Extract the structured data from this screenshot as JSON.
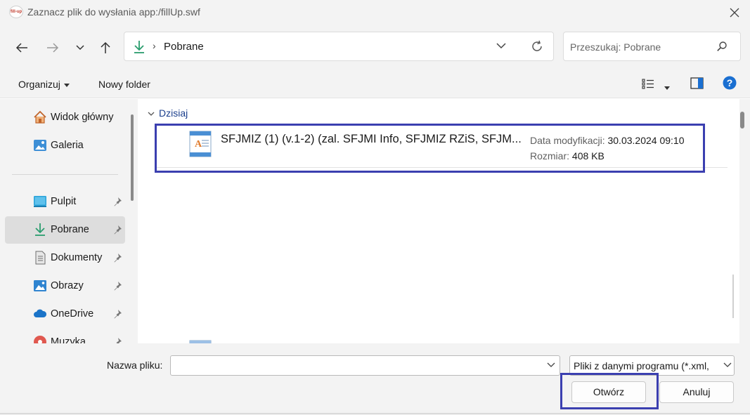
{
  "window": {
    "app_icon_text": "fill-up",
    "title": "Zaznacz plik do wysłania app:/fillUp.swf"
  },
  "nav": {
    "location": "Pobrane",
    "search_placeholder": "Przeszukaj: Pobrane"
  },
  "toolbar": {
    "organize_label": "Organizuj",
    "new_folder_label": "Nowy folder"
  },
  "sidebar": {
    "items": [
      {
        "label": "Widok główny",
        "icon": "home-icon"
      },
      {
        "label": "Galeria",
        "icon": "gallery-icon"
      },
      {
        "label": "Pulpit",
        "icon": "desktop-icon",
        "pinned": true
      },
      {
        "label": "Pobrane",
        "icon": "download-icon",
        "pinned": true,
        "selected": true
      },
      {
        "label": "Dokumenty",
        "icon": "documents-icon",
        "pinned": true
      },
      {
        "label": "Obrazy",
        "icon": "pictures-icon",
        "pinned": true
      },
      {
        "label": "OneDrive",
        "icon": "onedrive-icon",
        "pinned": true
      },
      {
        "label": "Muzyka",
        "icon": "music-icon",
        "pinned": true
      }
    ]
  },
  "content": {
    "group_label": "Dzisiaj",
    "files": [
      {
        "name": "SFJMIZ (1) (v.1-2) (zal. SFJMI Info, SFJMIZ RZiS, SFJM...",
        "modified_label": "Data modyfikacji:",
        "modified_value": "30.03.2024 09:10",
        "size_label": "Rozmiar:",
        "size_value": "408 KB"
      }
    ]
  },
  "footer": {
    "filename_label": "Nazwa pliku:",
    "filename_value": "",
    "filter_value": "Pliki z danymi programu (*.xml,",
    "open_label": "Otwórz",
    "cancel_label": "Anuluj"
  },
  "colors": {
    "highlight_box": "#3b3fb0",
    "accent_blue": "#1a6fd1",
    "download_green": "#2a9d6e",
    "chrome_bg": "#f3f3f3"
  }
}
